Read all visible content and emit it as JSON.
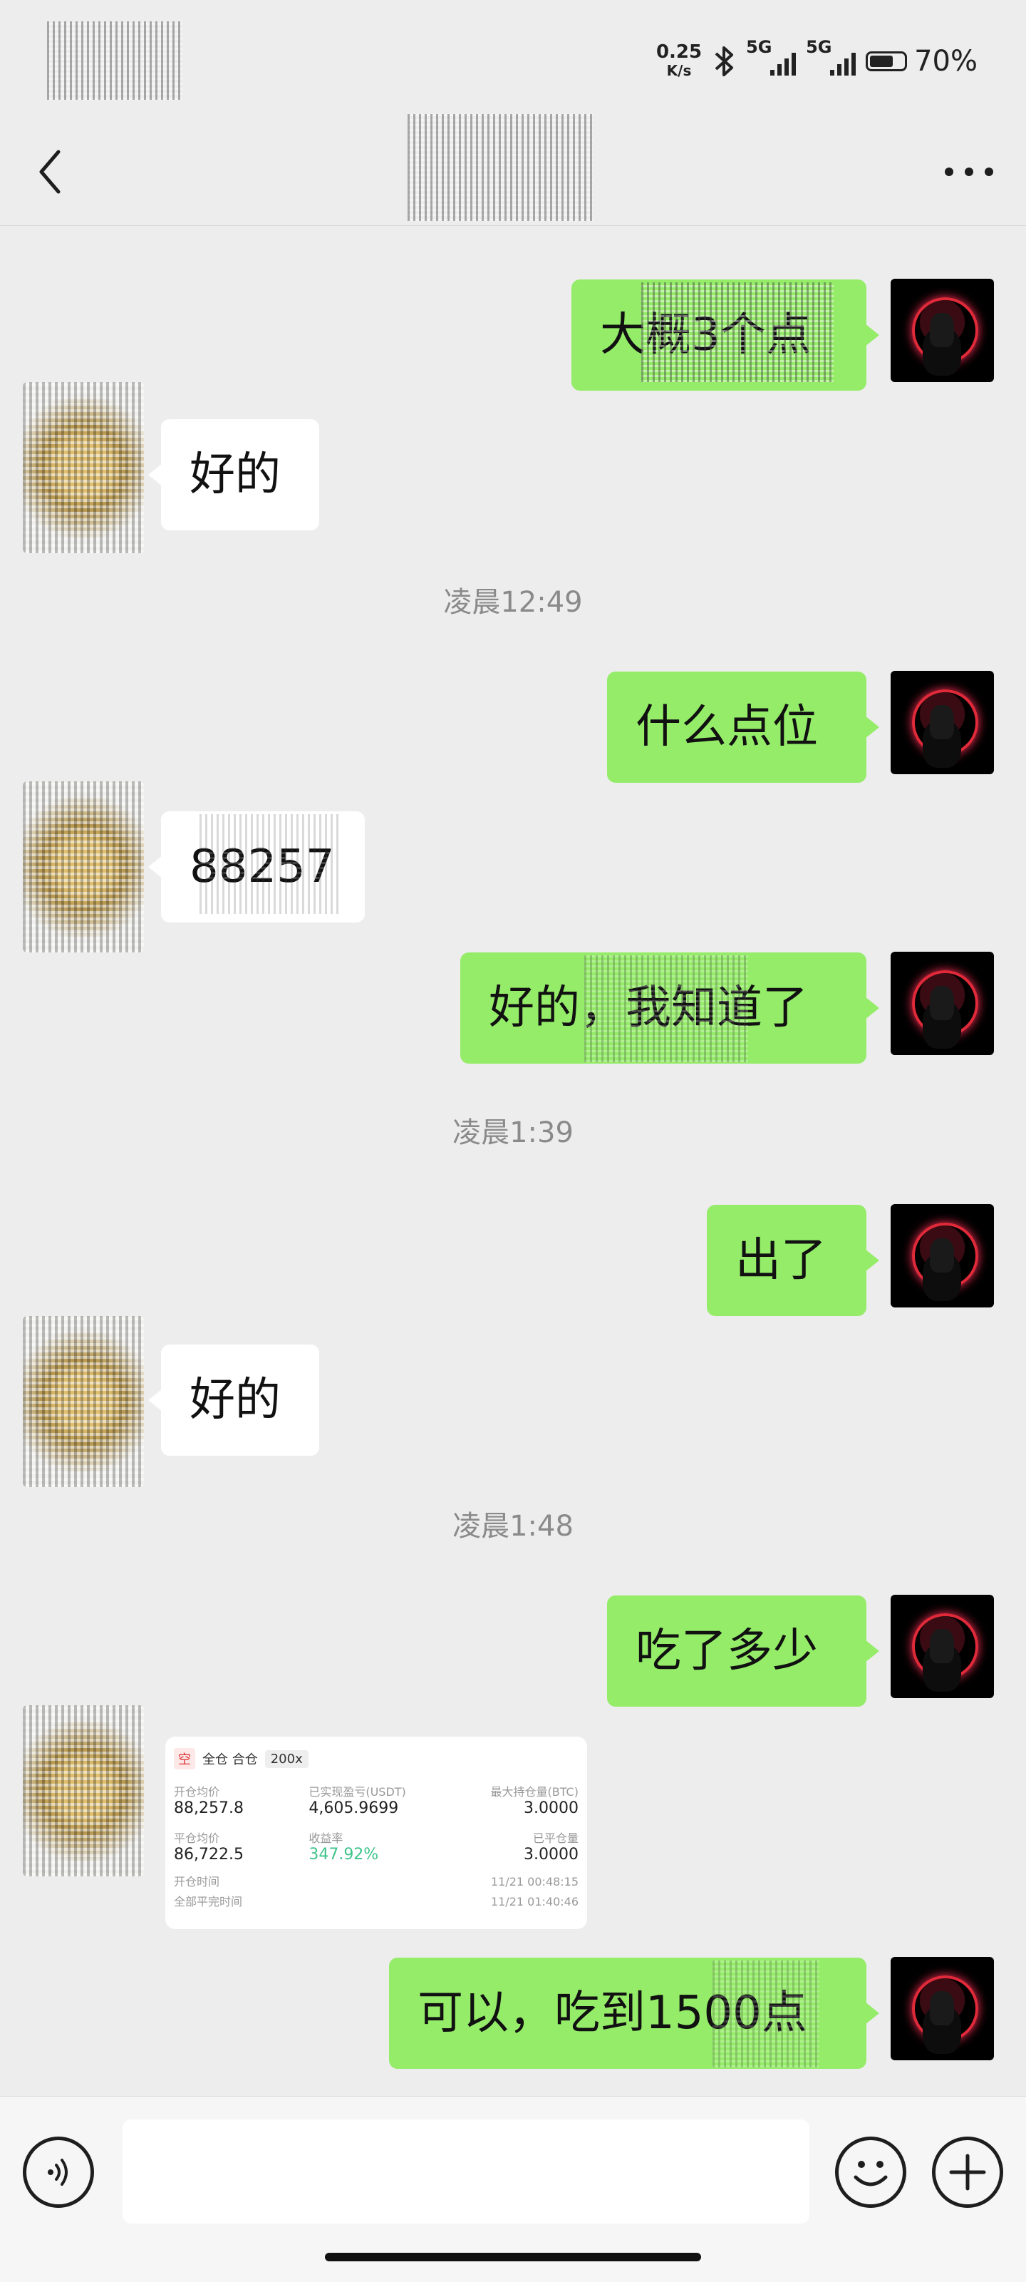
{
  "status_bar": {
    "net_speed_value": "0.25",
    "net_speed_unit": "K/s",
    "signal_1": "5G",
    "signal_2": "5G",
    "battery": "70%"
  },
  "nav": {
    "back_icon": "chevron-left-icon",
    "more_icon": "ellipsis-icon"
  },
  "messages": [
    {
      "dir": "out",
      "text": "大概3个点"
    },
    {
      "dir": "in",
      "text": "好的"
    },
    {
      "type": "time",
      "text": "凌晨12:49"
    },
    {
      "dir": "out",
      "text": "什么点位"
    },
    {
      "dir": "in",
      "text": "88257"
    },
    {
      "dir": "out",
      "text": "好的，我知道了"
    },
    {
      "type": "time",
      "text": "凌晨1:39"
    },
    {
      "dir": "out",
      "text": "出了"
    },
    {
      "dir": "in",
      "text": "好的"
    },
    {
      "type": "time",
      "text": "凌晨1:48"
    },
    {
      "dir": "out",
      "text": "吃了多少"
    },
    {
      "dir": "out",
      "text": "可以，吃到1500点"
    }
  ],
  "trade_card": {
    "side": "空",
    "mode": "全仓 合仓",
    "leverage": "200x",
    "open_price_label": "开仓均价",
    "open_price": "88,257.8",
    "realized_pnl_label": "已实现盈亏(USDT)",
    "realized_pnl": "4,605.9699",
    "max_position_label": "最大持仓量(BTC)",
    "max_position": "3.0000",
    "close_price_label": "平仓均价",
    "close_price": "86,722.5",
    "roi_label": "收益率",
    "roi": "347.92%",
    "closed_qty_label": "已平仓量",
    "closed_qty": "3.0000",
    "open_time_label": "开仓时间",
    "open_time": "11/21 00:48:15",
    "close_time_label": "全部平完时间",
    "close_time": "11/21 01:40:46"
  },
  "input_bar": {
    "voice_icon": "voice-icon",
    "emoji_icon": "emoji-icon",
    "plus_icon": "plus-icon",
    "placeholder": ""
  }
}
